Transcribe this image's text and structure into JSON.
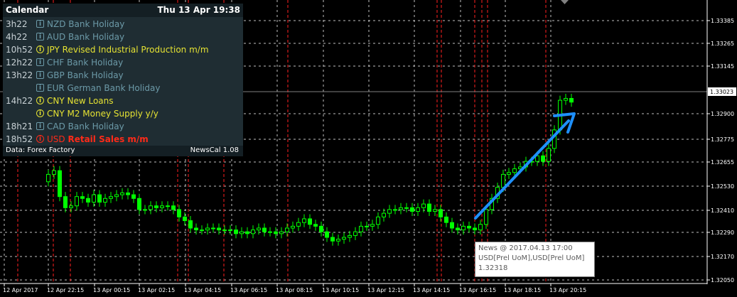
{
  "calendar": {
    "title": "Calendar",
    "datetime": "Thu 13 Apr 19:38",
    "events": [
      {
        "time": "3h22",
        "currency": "NZD",
        "title": "Bank Holiday",
        "impact": "low"
      },
      {
        "time": "4h22",
        "currency": "AUD",
        "title": "Bank Holiday",
        "impact": "low"
      },
      {
        "time": "10h52",
        "currency": "JPY",
        "title": "Revised Industrial Production m/m",
        "impact": "medium"
      },
      {
        "time": "12h22",
        "currency": "CHF",
        "title": "Bank Holiday",
        "impact": "low"
      },
      {
        "time": "13h22",
        "currency": "GBP",
        "title": "Bank Holiday",
        "impact": "low"
      },
      {
        "time": "",
        "currency": "EUR",
        "title": "German Bank Holiday",
        "impact": "low"
      },
      {
        "time": "14h22",
        "currency": "CNY",
        "title": "New Loans",
        "impact": "medium"
      },
      {
        "time": "",
        "currency": "CNY",
        "title": "M2 Money Supply y/y",
        "impact": "medium"
      },
      {
        "time": "18h21",
        "currency": "CAD",
        "title": "Bank Holiday",
        "impact": "low"
      },
      {
        "time": "18h52",
        "currency": "USD",
        "title": "Retail Sales m/m",
        "impact": "high"
      }
    ],
    "icon_glyph": "i",
    "source": "Data: Forex Factory",
    "version": "NewsCal 1.08"
  },
  "tooltip": {
    "line1": "News @ 2017.04.13 17:00",
    "line2": "USD[Prel UoM],USD[Prel UoM]",
    "line3": "1.32318"
  },
  "price_axis": {
    "labels": [
      "1.33385",
      "1.33265",
      "1.33145",
      "1.32900",
      "1.32775",
      "1.32655",
      "1.32530",
      "1.32410",
      "1.32290",
      "1.32170",
      "1.32050"
    ],
    "current_price": "1.33023"
  },
  "time_axis": {
    "labels": [
      "12 Apr 2017",
      "12 Apr 22:15",
      "13 Apr 00:15",
      "13 Apr 02:15",
      "13 Apr 04:15",
      "13 Apr 06:15",
      "13 Apr 08:15",
      "13 Apr 10:15",
      "13 Apr 12:15",
      "13 Apr 14:15",
      "13 Apr 16:15",
      "13 Apr 18:15",
      "13 Apr 20:15"
    ]
  },
  "colors": {
    "background": "#000000",
    "bull_candle": "#00ff00",
    "grid": "#c0c0c0",
    "news_line": "#ff2020",
    "current_price_line": "#808080",
    "arrow": "#1e90ff",
    "axis": "#ffffff"
  },
  "chart_data": {
    "type": "candlestick",
    "symbol_timeframe": "15 minute candles",
    "ylim": [
      1.3205,
      1.3345
    ],
    "trend_annotation": "up-arrow",
    "closes": [
      1.3262,
      1.3264,
      1.325,
      1.3244,
      1.3245,
      1.325,
      1.3249,
      1.3247,
      1.3251,
      1.3247,
      1.3249,
      1.325,
      1.3251,
      1.3252,
      1.3251,
      1.3249,
      1.3243,
      1.3243,
      1.3245,
      1.3244,
      1.3245,
      1.3245,
      1.3243,
      1.3239,
      1.3237,
      1.3233,
      1.3232,
      1.3232,
      1.3233,
      1.3233,
      1.3232,
      1.3232,
      1.3232,
      1.323,
      1.3231,
      1.323,
      1.3232,
      1.3233,
      1.3231,
      1.3231,
      1.323,
      1.3231,
      1.3233,
      1.3234,
      1.3236,
      1.3238,
      1.3235,
      1.3234,
      1.3231,
      1.3228,
      1.3226,
      1.3227,
      1.3228,
      1.3229,
      1.3231,
      1.3234,
      1.3234,
      1.3235,
      1.3239,
      1.3241,
      1.3243,
      1.3243,
      1.3244,
      1.3244,
      1.3242,
      1.3244,
      1.3246,
      1.3242,
      1.3243,
      1.3239,
      1.3236,
      1.3233,
      1.3232,
      1.3234,
      1.3233,
      1.3232,
      1.3235,
      1.3243,
      1.3249,
      1.3255,
      1.3262,
      1.3263,
      1.3265,
      1.3266,
      1.3269,
      1.3269,
      1.3272,
      1.3269,
      1.3276,
      1.3286,
      1.3302,
      1.3303,
      1.3301
    ]
  }
}
